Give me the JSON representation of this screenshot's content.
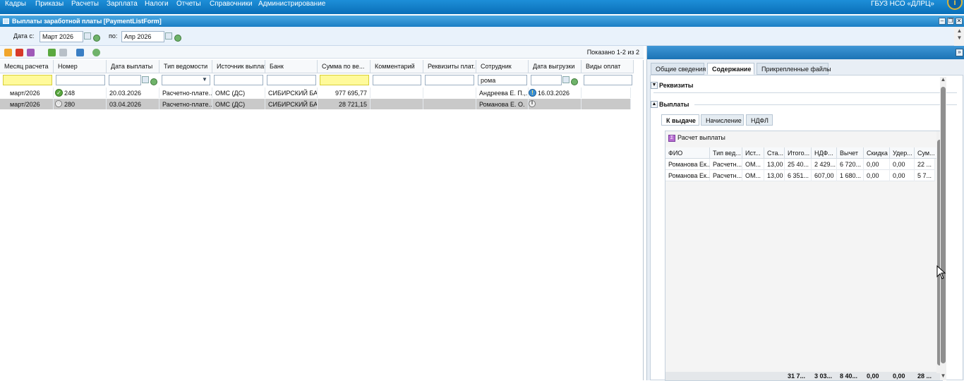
{
  "menu": [
    "Кадры",
    "Приказы",
    "Расчеты",
    "Зарплата",
    "Налоги",
    "Отчеты",
    "Справочники",
    "Администрирование"
  ],
  "org": "ГБУЗ НСО «ДЛРЦ»",
  "window": {
    "title": "Выплаты заработной платы [PaymentListForm]"
  },
  "filters": {
    "date_from_label": "Дата с:",
    "date_from": "Март 2026",
    "date_to_label": "по:",
    "date_to": "Апр 2026"
  },
  "toolbar": {
    "shown": "Показано 1-2 из 2"
  },
  "grid": {
    "columns": [
      "Месяц расчета",
      "Номер",
      "Дата выплаты",
      "Тип ведомости",
      "Источник выплат",
      "Банк",
      "Сумма по ве...",
      "Комментарий",
      "Реквизиты плат...",
      "Сотрудник",
      "Дата выгрузки",
      "Виды оплат"
    ],
    "filter_employee": "рома",
    "rows": [
      {
        "month": "март/2026",
        "number": "248",
        "pay_date": "20.03.2026",
        "type": "Расчетно-плате...",
        "source": "ОМС (ДС)",
        "bank": "СИБИРСКИЙ БА...",
        "sum": "977 695,77",
        "comment": "",
        "requisites": "",
        "employee": "Андреева Е. П.,...",
        "export_date": "16.03.2026",
        "pay_types": ""
      },
      {
        "month": "март/2026",
        "number": "280",
        "pay_date": "03.04.2026",
        "type": "Расчетно-плате...",
        "source": "ОМС (ДС)",
        "bank": "СИБИРСКИЙ БА...",
        "sum": "28 721,15",
        "comment": "",
        "requisites": "",
        "employee": "Романова Е. О.",
        "export_date": "",
        "pay_types": ""
      }
    ]
  },
  "detail": {
    "tabs": [
      "Общие сведения",
      "Содержание",
      "Прикрепленные файлы"
    ],
    "sec_requisites": "Реквизиты",
    "sec_payments": "Выплаты",
    "subtabs": [
      "К выдаче",
      "Начисление",
      "НДФЛ"
    ],
    "calc_button": "Расчет выплаты",
    "columns": [
      "ФИО",
      "Тип вед...",
      "Ист...",
      "Ста...",
      "Итого...",
      "НДФ...",
      "Вычет",
      "Скидка",
      "Удер...",
      "Сум..."
    ],
    "rows": [
      [
        "Романова Ек...",
        "Расчетн...",
        "ОМ...",
        "13,00",
        "25 40...",
        "2 429...",
        "6 720...",
        "0,00",
        "0,00",
        "22 ..."
      ],
      [
        "Романова Ек...",
        "Расчетн...",
        "ОМ...",
        "13,00",
        "6 351...",
        "607,00",
        "1 680...",
        "0,00",
        "0,00",
        "5 7..."
      ]
    ],
    "totals": [
      "31 7...",
      "3 03...",
      "8 40...",
      "0,00",
      "0,00",
      "28 ..."
    ]
  }
}
